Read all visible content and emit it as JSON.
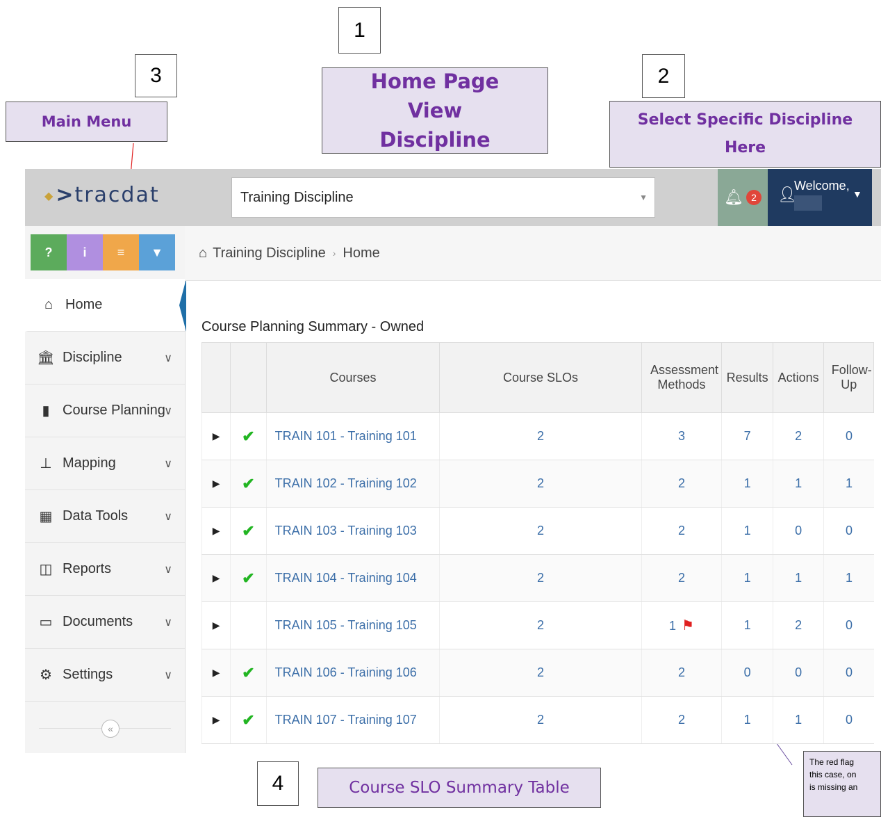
{
  "callouts": {
    "num1": "1",
    "num2": "2",
    "num3": "3",
    "num4": "4",
    "home_view": "Home Page View Discipline",
    "main_menu": "Main Menu",
    "select_discipline": "Select Specific Discipline Here",
    "slo_table": "Course SLO Summary Table",
    "note_line1": "The red flag",
    "note_line2": "this case, on",
    "note_line3": "is missing an"
  },
  "header": {
    "logo": "tracdat",
    "discipline_value": "Training Discipline",
    "notifications": "2",
    "welcome": "Welcome,"
  },
  "quick_buttons": [
    {
      "label": "?",
      "color": "#5cab5c"
    },
    {
      "label": "i",
      "color": "#b08fe0"
    },
    {
      "label": "≡",
      "color": "#f0a74a"
    },
    {
      "label": "▼",
      "color": "#5ba1d8"
    }
  ],
  "sidebar": {
    "items": [
      {
        "label": "Home",
        "icon": "home-icon"
      },
      {
        "label": "Discipline",
        "icon": "bank-icon"
      },
      {
        "label": "Course Planning",
        "icon": "book-icon"
      },
      {
        "label": "Mapping",
        "icon": "sitemap-icon"
      },
      {
        "label": "Data Tools",
        "icon": "table-icon"
      },
      {
        "label": "Reports",
        "icon": "columns-icon"
      },
      {
        "label": "Documents",
        "icon": "folder-icon"
      },
      {
        "label": "Settings",
        "icon": "gear-icon"
      }
    ],
    "collapse": "«"
  },
  "breadcrumb": {
    "discipline": "Training Discipline",
    "page": "Home"
  },
  "summary": {
    "title": "Course Planning Summary - Owned",
    "headers": [
      "Courses",
      "Course SLOs",
      "Assessment Methods",
      "Results",
      "Actions",
      "Follow-Up"
    ],
    "rows": [
      {
        "course": "TRAIN 101 - Training 101",
        "slos": "2",
        "methods": "3",
        "results": "7",
        "actions": "2",
        "followup": "0",
        "check": true
      },
      {
        "course": "TRAIN 102 - Training 102",
        "slos": "2",
        "methods": "2",
        "results": "1",
        "actions": "1",
        "followup": "1",
        "check": true
      },
      {
        "course": "TRAIN 103 - Training 103",
        "slos": "2",
        "methods": "2",
        "results": "1",
        "actions": "0",
        "followup": "0",
        "check": true
      },
      {
        "course": "TRAIN 104 - Training 104",
        "slos": "2",
        "methods": "2",
        "results": "1",
        "actions": "1",
        "followup": "1",
        "check": true
      },
      {
        "course": "TRAIN 105 - Training 105",
        "slos": "2",
        "methods": "1",
        "results": "1",
        "actions": "2",
        "followup": "0",
        "check": false,
        "flag": true
      },
      {
        "course": "TRAIN 106 - Training 106",
        "slos": "2",
        "methods": "2",
        "results": "0",
        "actions": "0",
        "followup": "0",
        "check": true
      },
      {
        "course": "TRAIN 107 - Training 107",
        "slos": "2",
        "methods": "2",
        "results": "1",
        "actions": "1",
        "followup": "0",
        "check": true
      }
    ]
  }
}
